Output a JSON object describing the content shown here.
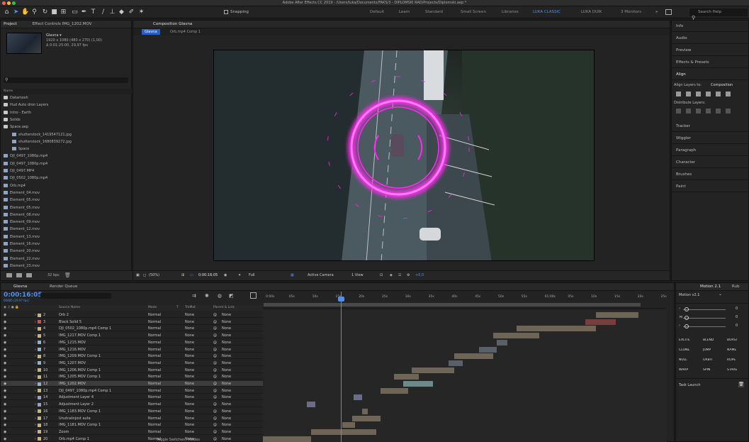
{
  "window": {
    "title": "Adobe After Effects CC 2019 - /Users/luka/Documents/FAKS/3 - DIPLOMSKI RAD/Projects/Diplomski.aep *"
  },
  "toolbar": {
    "snapping_label": "Snapping",
    "workspaces": [
      "Default",
      "Learn",
      "Standard",
      "Small Screen",
      "Libraries",
      "LUKA CLASSIC",
      "LUKA DUIK",
      "3 Monitors"
    ],
    "active_workspace": "LUKA CLASSIC",
    "search_placeholder": "Search Help"
  },
  "project_panel": {
    "tab_project": "Project",
    "tab_effect_controls": "Effect Controls IMG_1202.MOV",
    "selected_name": "Glavna ▾",
    "selected_meta_1": "1920 x 1080 (480 x 270) (1,00)",
    "selected_meta_2": "Δ 0:01:25:00, 29,97 fps",
    "column_name": "Name",
    "items": [
      {
        "label": "Datamosh",
        "type": "folder",
        "indent": 0
      },
      {
        "label": "Hud Auto dron Layers",
        "type": "folder",
        "indent": 0
      },
      {
        "label": "Intro - Earth",
        "type": "folder",
        "indent": 0
      },
      {
        "label": "Solids",
        "type": "folder",
        "indent": 0
      },
      {
        "label": "Space.aep",
        "type": "folder",
        "indent": 0
      },
      {
        "label": "shutterstock_1419547121.jpg",
        "type": "file",
        "indent": 2
      },
      {
        "label": "shutterstock_1680839272.jpg",
        "type": "file",
        "indent": 2
      },
      {
        "label": "Space",
        "type": "comp",
        "indent": 2
      },
      {
        "label": "DJI_0497_1080p.mp4",
        "type": "file",
        "indent": 0
      },
      {
        "label": "DJI_0497_1080p.mp4",
        "type": "file",
        "indent": 0
      },
      {
        "label": "DJI_0497.MP4",
        "type": "file",
        "indent": 0
      },
      {
        "label": "DJI_0502_1080p.mp4",
        "type": "file",
        "indent": 0
      },
      {
        "label": "Orb.mp4",
        "type": "file",
        "indent": 0
      },
      {
        "label": "Element_04.mov",
        "type": "file",
        "indent": 0
      },
      {
        "label": "Element_05.mov",
        "type": "file",
        "indent": 0
      },
      {
        "label": "Element_05.mov",
        "type": "file",
        "indent": 0
      },
      {
        "label": "Element_08.mov",
        "type": "file",
        "indent": 0
      },
      {
        "label": "Element_09.mov",
        "type": "file",
        "indent": 0
      },
      {
        "label": "Element_12.mov",
        "type": "file",
        "indent": 0
      },
      {
        "label": "Element_13.mov",
        "type": "file",
        "indent": 0
      },
      {
        "label": "Element_16.mov",
        "type": "file",
        "indent": 0
      },
      {
        "label": "Element_20.mov",
        "type": "file",
        "indent": 0
      },
      {
        "label": "Element_22.mov",
        "type": "file",
        "indent": 0
      },
      {
        "label": "Element_23.mov",
        "type": "file",
        "indent": 0
      }
    ],
    "bpc": "32 bpc"
  },
  "comp_panel": {
    "tab_label": "Composition Glavna",
    "subtab_active": "Glavna",
    "subtab_other": "Orb.mp4 Comp 1",
    "zoom": "(50%)",
    "timecode": "0:00:16:05",
    "resolution": "Full",
    "camera": "Active Camera",
    "view": "1 View",
    "exposure": "+0,0"
  },
  "right_panels": {
    "items": [
      "Info",
      "Audio",
      "Preview",
      "Effects & Presets"
    ],
    "align_title": "Align",
    "align_layers_to_label": "Align Layers to:",
    "align_layers_to_value": "Composition",
    "distribute_label": "Distribute Layers:",
    "more_items": [
      "Tracker",
      "Wiggler",
      "Paragraph",
      "Character",
      "Brushes",
      "Paint"
    ]
  },
  "timeline": {
    "tab_label": "Glavna",
    "render_queue_label": "Render Queue",
    "current_time": "0:00:16:05",
    "frames_label": "00485 (29.97 fps)",
    "col_source": "Source Name",
    "col_mode": "Mode",
    "col_t": "T",
    "col_trkmat": "TrkMat",
    "col_parent": "Parent & Link",
    "toggle_label": "Toggle Switches / Modes",
    "ruler_ticks": [
      "0:00s",
      "05s",
      "10s",
      "15s",
      "20s",
      "25s",
      "30s",
      "35s",
      "40s",
      "45s",
      "50s",
      "55s",
      "01:00s",
      "05s",
      "10s",
      "15s",
      "20s",
      "25s"
    ],
    "layers": [
      {
        "num": "2",
        "color": "#c7b47a",
        "name": "Orb 2",
        "mode": "Normal",
        "trkmat": "None",
        "parent": "None"
      },
      {
        "num": "3",
        "color": "#d64a4a",
        "name": "Black Solid 5",
        "mode": "Normal",
        "trkmat": "None",
        "parent": "None"
      },
      {
        "num": "4",
        "color": "#c7b47a",
        "name": "DJI_0502_1080p.mp4 Comp 1",
        "mode": "Normal",
        "trkmat": "None",
        "parent": "None"
      },
      {
        "num": "5",
        "color": "#c7b47a",
        "name": "IMG_1217.MOV Comp 1",
        "mode": "Normal",
        "trkmat": "None",
        "parent": "None"
      },
      {
        "num": "6",
        "color": "#8fb3c9",
        "name": "IMG_1215.MOV",
        "mode": "Normal",
        "trkmat": "None",
        "parent": "None"
      },
      {
        "num": "7",
        "color": "#8fb3c9",
        "name": "IMG_1216.MOV",
        "mode": "Normal",
        "trkmat": "None",
        "parent": "None"
      },
      {
        "num": "8",
        "color": "#c7b47a",
        "name": "IMG_1209.MOV Comp 1",
        "mode": "Normal",
        "trkmat": "None",
        "parent": "None"
      },
      {
        "num": "9",
        "color": "#8fb3c9",
        "name": "IMG_1207.MOV",
        "mode": "Normal",
        "trkmat": "None",
        "parent": "None"
      },
      {
        "num": "10",
        "color": "#c7b47a",
        "name": "IMG_1206.MOV Comp 1",
        "mode": "Normal",
        "trkmat": "None",
        "parent": "None"
      },
      {
        "num": "11",
        "color": "#c7b47a",
        "name": "IMG_1205.MOV Comp 1",
        "mode": "Normal",
        "trkmat": "None",
        "parent": "None"
      },
      {
        "num": "12",
        "color": "#8fb3c9",
        "name": "IMG_1202.MOV",
        "mode": "Normal",
        "trkmat": "None",
        "parent": "None",
        "selected": true
      },
      {
        "num": "13",
        "color": "#c7b47a",
        "name": "DJI_0497_1080p.mp4 Comp 1",
        "mode": "Normal",
        "trkmat": "None",
        "parent": "None"
      },
      {
        "num": "14",
        "color": "#9aa0c8",
        "name": "Adjustment Layer 4",
        "mode": "Normal",
        "trkmat": "None",
        "parent": "None"
      },
      {
        "num": "15",
        "color": "#9aa0c8",
        "name": "Adjustment Layer 2",
        "mode": "Normal",
        "trkmat": "None",
        "parent": "None"
      },
      {
        "num": "16",
        "color": "#c7b47a",
        "name": "IMG_1183.MOV Comp 1",
        "mode": "Normal",
        "trkmat": "None",
        "parent": "None"
      },
      {
        "num": "17",
        "color": "#c7b47a",
        "name": "Unutrašnjost auta",
        "mode": "Normal",
        "trkmat": "None",
        "parent": "None"
      },
      {
        "num": "18",
        "color": "#c7b47a",
        "name": "IMG_1181.MOV Comp 1",
        "mode": "Normal",
        "trkmat": "None",
        "parent": "None"
      },
      {
        "num": "19",
        "color": "#c7b47a",
        "name": "Zoom",
        "mode": "Normal",
        "trkmat": "None",
        "parent": "None"
      },
      {
        "num": "20",
        "color": "#c7b47a",
        "name": "Orb.mp4 Comp 1",
        "mode": "Normal",
        "trkmat": "None",
        "parent": "None"
      }
    ]
  },
  "motion_panel": {
    "tab_label": "Motion 2.1",
    "tab_other": "Rub",
    "version": "Motion v2.1",
    "value_zero": "0",
    "buttons": [
      "EXCITE",
      "BLEND",
      "BURST",
      "CLONE",
      "JUMP",
      "NAME",
      "NULL",
      "ORBIT",
      "ROPE",
      "WARP",
      "SPIN",
      "STARE"
    ],
    "task_launch": "Task Launch"
  },
  "colors": {
    "accent_blue": "#4f8ff0",
    "orb_magenta": "#ff29f0",
    "panel_bg": "#232323"
  }
}
